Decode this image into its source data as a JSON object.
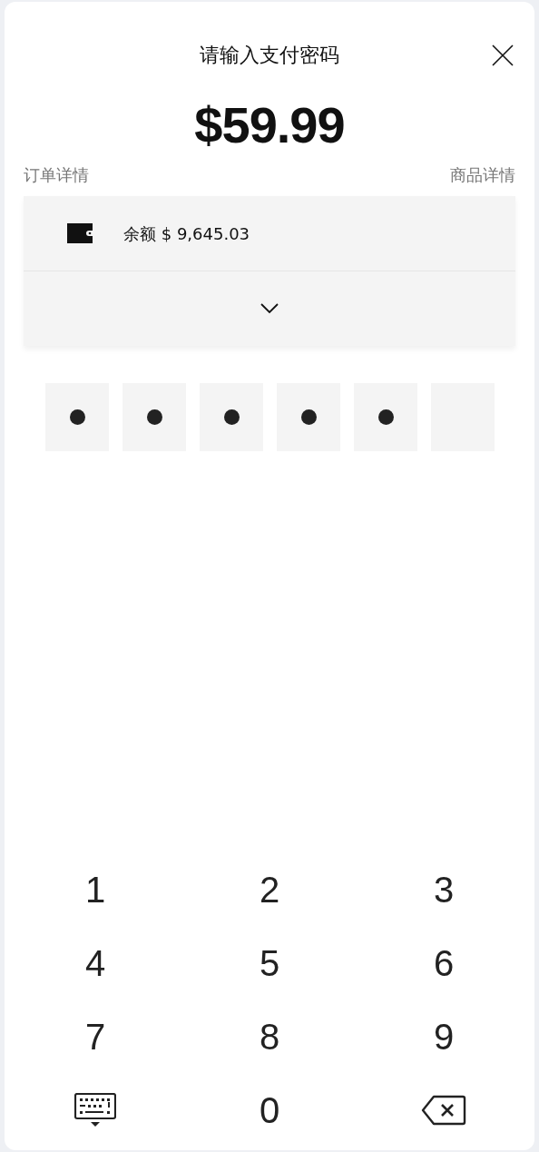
{
  "title": "请输入支付密码",
  "amount": "$59.99",
  "links": [
    "订单详情",
    "商品详情"
  ],
  "balance": "余额 $ 9,645.03",
  "pin": [
    {
      "filled": true
    },
    {
      "filled": true
    },
    {
      "filled": true
    },
    {
      "filled": true
    },
    {
      "filled": true
    },
    {
      "filled": false
    }
  ],
  "keypad": [
    {
      "kind": "digit",
      "label": "1"
    },
    {
      "kind": "digit",
      "label": "2"
    },
    {
      "kind": "digit",
      "label": "3"
    },
    {
      "kind": "digit",
      "label": "4"
    },
    {
      "kind": "digit",
      "label": "5"
    },
    {
      "kind": "digit",
      "label": "6"
    },
    {
      "kind": "digit",
      "label": "7"
    },
    {
      "kind": "digit",
      "label": "8"
    },
    {
      "kind": "digit",
      "label": "9"
    },
    {
      "kind": "keyboard"
    },
    {
      "kind": "digit",
      "label": "0"
    },
    {
      "kind": "backspace"
    }
  ]
}
